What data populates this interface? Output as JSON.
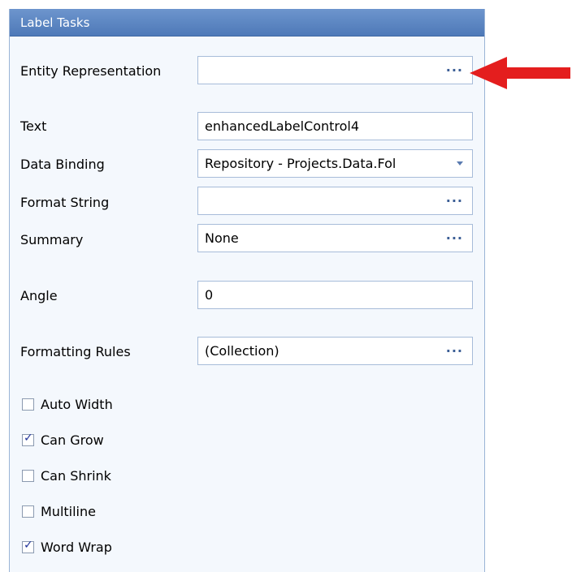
{
  "panel": {
    "title": "Label Tasks"
  },
  "properties": {
    "entity_representation": {
      "label": "Entity Representation",
      "value": "",
      "button": "..."
    },
    "text": {
      "label": "Text",
      "value": "enhancedLabelControl4"
    },
    "data_binding": {
      "label": "Data Binding",
      "value": "Repository - Projects.Data.Fol"
    },
    "format_string": {
      "label": "Format String",
      "value": "",
      "button": "..."
    },
    "summary": {
      "label": "Summary",
      "value": "None",
      "button": "..."
    },
    "angle": {
      "label": "Angle",
      "value": "0"
    },
    "formatting_rules": {
      "label": "Formatting Rules",
      "value": "(Collection)",
      "button": "..."
    }
  },
  "options": [
    {
      "label": "Auto Width",
      "checked": false
    },
    {
      "label": "Can Grow",
      "checked": true
    },
    {
      "label": "Can Shrink",
      "checked": false
    },
    {
      "label": "Multiline",
      "checked": false
    },
    {
      "label": "Word Wrap",
      "checked": true
    }
  ],
  "colors": {
    "title_bar": "#5a84c2",
    "panel_background": "#f4f8fd",
    "annotation_arrow": "#e41e1e"
  }
}
